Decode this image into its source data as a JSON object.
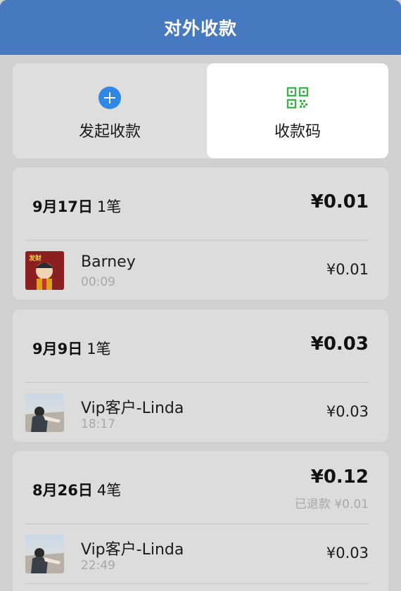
{
  "header": {
    "title": "对外收款"
  },
  "tabs": [
    {
      "label": "发起收款",
      "icon": "plus-circle-icon"
    },
    {
      "label": "收款码",
      "icon": "qr-code-icon"
    }
  ],
  "colors": {
    "header": "#4679bf",
    "accent_blue": "#2f87e6",
    "qr_green": "#3db14a"
  },
  "groups": [
    {
      "date": "9月17日",
      "count": "1笔",
      "total": "¥0.01",
      "refund": "",
      "items": [
        {
          "name": "Barney",
          "time": "00:09",
          "amount": "¥0.01",
          "avatar": "avatar-icon"
        }
      ]
    },
    {
      "date": "9月9日",
      "count": "1笔",
      "total": "¥0.03",
      "refund": "",
      "items": [
        {
          "name": "Vip客户-Linda",
          "time": "18:17",
          "amount": "¥0.03",
          "avatar": "avatar-icon"
        }
      ]
    },
    {
      "date": "8月26日",
      "count": "4笔",
      "total": "¥0.12",
      "refund": "已退款 ¥0.01",
      "items": [
        {
          "name": "Vip客户-Linda",
          "time": "22:49",
          "amount": "¥0.03",
          "avatar": "avatar-icon"
        }
      ]
    }
  ]
}
